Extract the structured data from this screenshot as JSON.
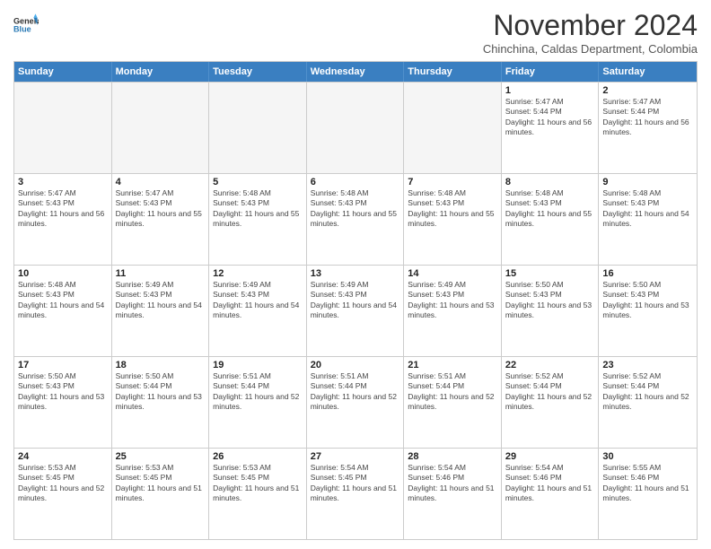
{
  "logo": {
    "line1": "General",
    "line2": "Blue"
  },
  "title": "November 2024",
  "location": "Chinchina, Caldas Department, Colombia",
  "header": {
    "days": [
      "Sunday",
      "Monday",
      "Tuesday",
      "Wednesday",
      "Thursday",
      "Friday",
      "Saturday"
    ]
  },
  "weeks": [
    [
      {
        "day": "",
        "empty": true
      },
      {
        "day": "",
        "empty": true
      },
      {
        "day": "",
        "empty": true
      },
      {
        "day": "",
        "empty": true
      },
      {
        "day": "",
        "empty": true
      },
      {
        "day": "1",
        "sunrise": "5:47 AM",
        "sunset": "5:44 PM",
        "daylight": "11 hours and 56 minutes."
      },
      {
        "day": "2",
        "sunrise": "5:47 AM",
        "sunset": "5:44 PM",
        "daylight": "11 hours and 56 minutes."
      }
    ],
    [
      {
        "day": "3",
        "sunrise": "5:47 AM",
        "sunset": "5:43 PM",
        "daylight": "11 hours and 56 minutes."
      },
      {
        "day": "4",
        "sunrise": "5:47 AM",
        "sunset": "5:43 PM",
        "daylight": "11 hours and 55 minutes."
      },
      {
        "day": "5",
        "sunrise": "5:48 AM",
        "sunset": "5:43 PM",
        "daylight": "11 hours and 55 minutes."
      },
      {
        "day": "6",
        "sunrise": "5:48 AM",
        "sunset": "5:43 PM",
        "daylight": "11 hours and 55 minutes."
      },
      {
        "day": "7",
        "sunrise": "5:48 AM",
        "sunset": "5:43 PM",
        "daylight": "11 hours and 55 minutes."
      },
      {
        "day": "8",
        "sunrise": "5:48 AM",
        "sunset": "5:43 PM",
        "daylight": "11 hours and 55 minutes."
      },
      {
        "day": "9",
        "sunrise": "5:48 AM",
        "sunset": "5:43 PM",
        "daylight": "11 hours and 54 minutes."
      }
    ],
    [
      {
        "day": "10",
        "sunrise": "5:48 AM",
        "sunset": "5:43 PM",
        "daylight": "11 hours and 54 minutes."
      },
      {
        "day": "11",
        "sunrise": "5:49 AM",
        "sunset": "5:43 PM",
        "daylight": "11 hours and 54 minutes."
      },
      {
        "day": "12",
        "sunrise": "5:49 AM",
        "sunset": "5:43 PM",
        "daylight": "11 hours and 54 minutes."
      },
      {
        "day": "13",
        "sunrise": "5:49 AM",
        "sunset": "5:43 PM",
        "daylight": "11 hours and 54 minutes."
      },
      {
        "day": "14",
        "sunrise": "5:49 AM",
        "sunset": "5:43 PM",
        "daylight": "11 hours and 53 minutes."
      },
      {
        "day": "15",
        "sunrise": "5:50 AM",
        "sunset": "5:43 PM",
        "daylight": "11 hours and 53 minutes."
      },
      {
        "day": "16",
        "sunrise": "5:50 AM",
        "sunset": "5:43 PM",
        "daylight": "11 hours and 53 minutes."
      }
    ],
    [
      {
        "day": "17",
        "sunrise": "5:50 AM",
        "sunset": "5:43 PM",
        "daylight": "11 hours and 53 minutes."
      },
      {
        "day": "18",
        "sunrise": "5:50 AM",
        "sunset": "5:44 PM",
        "daylight": "11 hours and 53 minutes."
      },
      {
        "day": "19",
        "sunrise": "5:51 AM",
        "sunset": "5:44 PM",
        "daylight": "11 hours and 52 minutes."
      },
      {
        "day": "20",
        "sunrise": "5:51 AM",
        "sunset": "5:44 PM",
        "daylight": "11 hours and 52 minutes."
      },
      {
        "day": "21",
        "sunrise": "5:51 AM",
        "sunset": "5:44 PM",
        "daylight": "11 hours and 52 minutes."
      },
      {
        "day": "22",
        "sunrise": "5:52 AM",
        "sunset": "5:44 PM",
        "daylight": "11 hours and 52 minutes."
      },
      {
        "day": "23",
        "sunrise": "5:52 AM",
        "sunset": "5:44 PM",
        "daylight": "11 hours and 52 minutes."
      }
    ],
    [
      {
        "day": "24",
        "sunrise": "5:53 AM",
        "sunset": "5:45 PM",
        "daylight": "11 hours and 52 minutes."
      },
      {
        "day": "25",
        "sunrise": "5:53 AM",
        "sunset": "5:45 PM",
        "daylight": "11 hours and 51 minutes."
      },
      {
        "day": "26",
        "sunrise": "5:53 AM",
        "sunset": "5:45 PM",
        "daylight": "11 hours and 51 minutes."
      },
      {
        "day": "27",
        "sunrise": "5:54 AM",
        "sunset": "5:45 PM",
        "daylight": "11 hours and 51 minutes."
      },
      {
        "day": "28",
        "sunrise": "5:54 AM",
        "sunset": "5:46 PM",
        "daylight": "11 hours and 51 minutes."
      },
      {
        "day": "29",
        "sunrise": "5:54 AM",
        "sunset": "5:46 PM",
        "daylight": "11 hours and 51 minutes."
      },
      {
        "day": "30",
        "sunrise": "5:55 AM",
        "sunset": "5:46 PM",
        "daylight": "11 hours and 51 minutes."
      }
    ]
  ]
}
